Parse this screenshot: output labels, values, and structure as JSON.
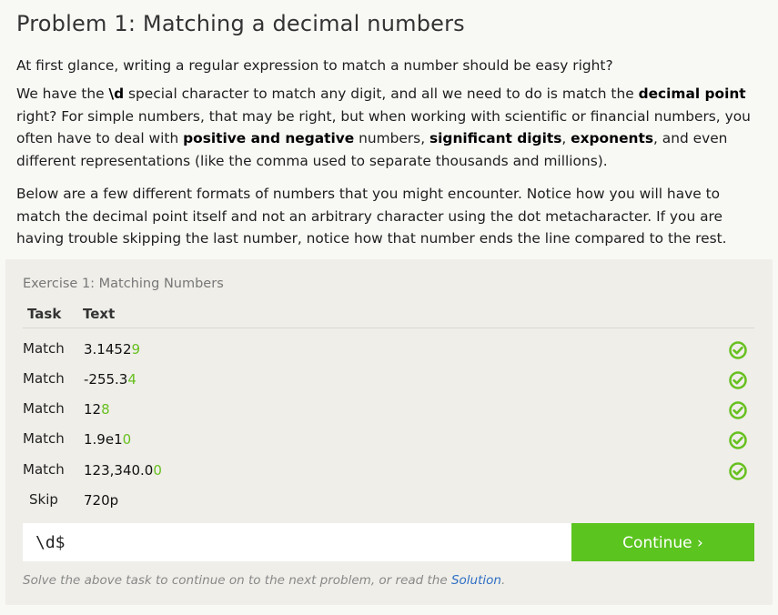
{
  "problem": {
    "title": "Problem 1: Matching a decimal numbers",
    "intro": "At first glance, writing a regular expression to match a number should be easy right?",
    "p2": {
      "t1": "We have the ",
      "b1": "\\d",
      "t2": " special character to match any digit, and all we need to do is match the ",
      "b2": "decimal point",
      "t3": " right? For simple numbers, that may be right, but when working with scientific or financial numbers, you often have to deal with ",
      "b3": "positive and negative",
      "t4": " numbers, ",
      "b4": "significant digits",
      "t5": ", ",
      "b5": "exponents",
      "t6": ", and even different representations (like the comma used to separate thousands and millions)."
    },
    "p3": "Below are a few different formats of numbers that you might encounter. Notice how you will have to match the decimal point itself and not an arbitrary character using the dot metacharacter. If you are having trouble skipping the last number, notice how that number ends the line compared to the rest."
  },
  "exercise": {
    "title": "Exercise 1: Matching Numbers",
    "headers": {
      "task": "Task",
      "text": "Text"
    },
    "rows": [
      {
        "task": "Match",
        "plain": "3.1452",
        "match": "9",
        "passed": true
      },
      {
        "task": "Match",
        "plain": "-255.3",
        "match": "4",
        "passed": true
      },
      {
        "task": "Match",
        "plain": "12",
        "match": "8",
        "passed": true
      },
      {
        "task": "Match",
        "plain": "1.9e1",
        "match": "0",
        "passed": true
      },
      {
        "task": "Match",
        "plain": "123,340.0",
        "match": "0",
        "passed": true
      },
      {
        "task": "Skip",
        "plain": "720p",
        "match": "",
        "passed": false
      }
    ],
    "input_value": "\\d$",
    "continue_label": "Continue ›",
    "hint_prefix": "Solve the above task to continue on to the next problem, or read the ",
    "hint_link": "Solution",
    "hint_suffix": ".",
    "colors": {
      "accent": "#5bc41f",
      "match_highlight": "#67c01f",
      "link": "#2f6fc4"
    }
  }
}
